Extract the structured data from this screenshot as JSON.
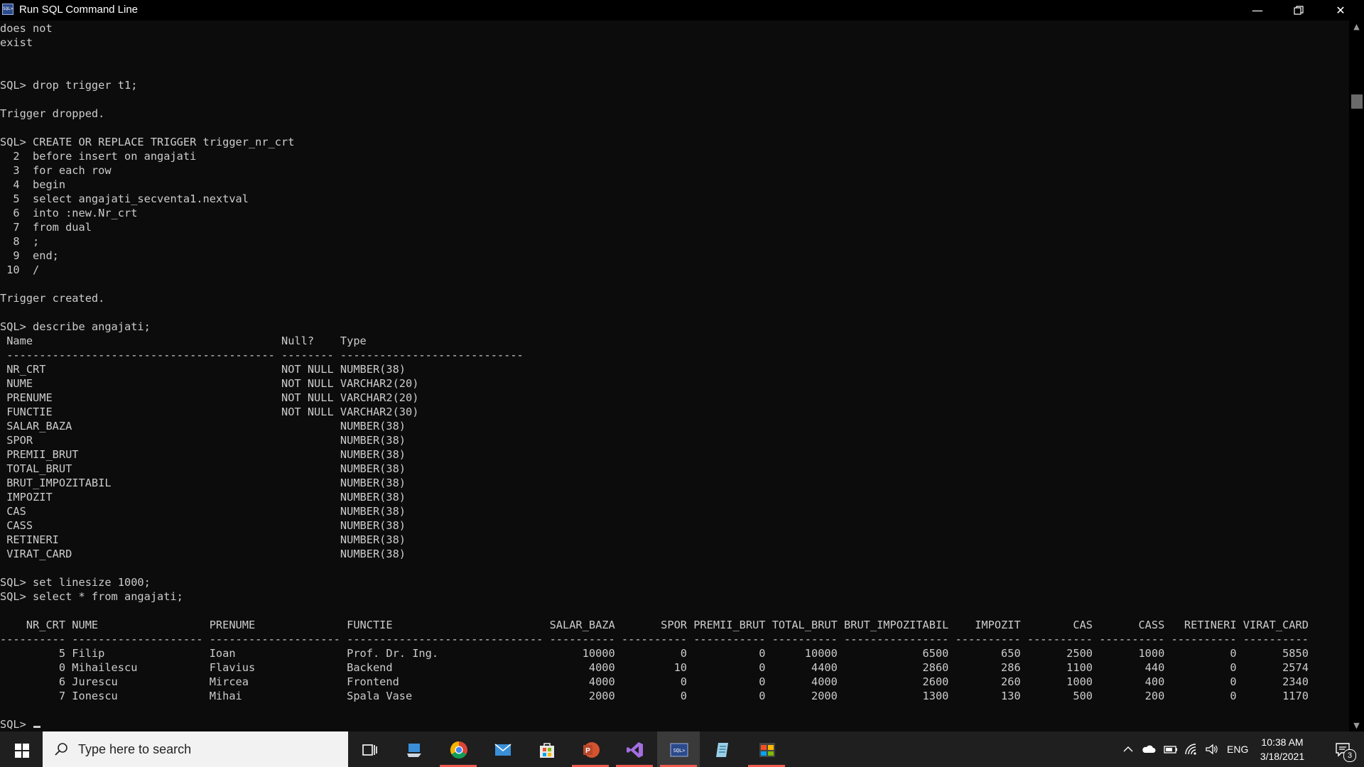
{
  "window": {
    "title": "Run SQL Command Line",
    "app_icon_text": "SQL>",
    "controls": [
      "minimize",
      "restore",
      "close"
    ]
  },
  "console": {
    "lines": [
      "does not",
      "exist",
      "",
      "",
      "SQL> drop trigger t1;",
      "",
      "Trigger dropped.",
      "",
      "SQL> CREATE OR REPLACE TRIGGER trigger_nr_crt",
      "  2  before insert on angajati",
      "  3  for each row",
      "  4  begin",
      "  5  select angajati_secventa1.nextval",
      "  6  into :new.Nr_crt",
      "  7  from dual",
      "  8  ;",
      "  9  end;",
      " 10  /",
      "",
      "Trigger created.",
      "",
      "SQL> describe angajati;",
      " Name                                      Null?    Type",
      " ----------------------------------------- -------- ----------------------------",
      " NR_CRT                                    NOT NULL NUMBER(38)",
      " NUME                                      NOT NULL VARCHAR2(20)",
      " PRENUME                                   NOT NULL VARCHAR2(20)",
      " FUNCTIE                                   NOT NULL VARCHAR2(30)",
      " SALAR_BAZA                                         NUMBER(38)",
      " SPOR                                               NUMBER(38)",
      " PREMII_BRUT                                        NUMBER(38)",
      " TOTAL_BRUT                                         NUMBER(38)",
      " BRUT_IMPOZITABIL                                   NUMBER(38)",
      " IMPOZIT                                            NUMBER(38)",
      " CAS                                                NUMBER(38)",
      " CASS                                               NUMBER(38)",
      " RETINERI                                           NUMBER(38)",
      " VIRAT_CARD                                         NUMBER(38)",
      "",
      "SQL> set linesize 1000;",
      "SQL> select * from angajati;",
      "",
      "    NR_CRT NUME                 PRENUME              FUNCTIE                        SALAR_BAZA       SPOR PREMII_BRUT TOTAL_BRUT BRUT_IMPOZITABIL    IMPOZIT        CAS       CASS   RETINERI VIRAT_CARD",
      "---------- -------------------- -------------------- ------------------------------ ---------- ---------- ----------- ---------- ---------------- ---------- ---------- ---------- ---------- ----------",
      "         5 Filip                Ioan                 Prof. Dr. Ing.                      10000          0           0      10000             6500        650       2500       1000          0       5850",
      "         0 Mihailescu           Flavius              Backend                              4000         10           0       4400             2860        286       1100        440          0       2574",
      "         6 Jurescu              Mircea               Frontend                             4000          0           0       4000             2600        260       1000        400          0       2340",
      "         7 Ionescu              Mihai                Spala Vase                           2000          0           0       2000             1300        130        500        200          0       1170",
      "",
      "SQL> "
    ]
  },
  "scrollbar": {
    "up_arrow": "▲",
    "down_arrow": "▼"
  },
  "taskbar": {
    "search_placeholder": "Type here to search",
    "apps": [
      "task-view",
      "file-explorer",
      "chrome",
      "mail",
      "store",
      "powerpoint",
      "visual-studio",
      "sql-command-line",
      "notepad",
      "windows-app"
    ],
    "tray": {
      "language": "ENG",
      "time": "10:38 AM",
      "date": "3/18/2021",
      "notification_count": "3"
    }
  }
}
